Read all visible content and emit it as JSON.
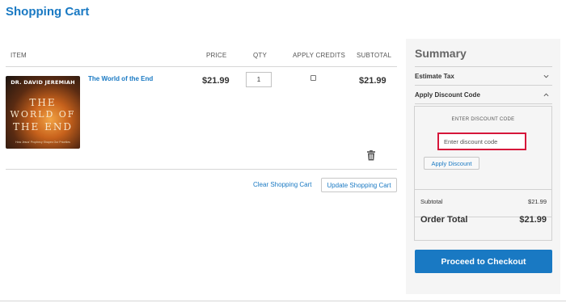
{
  "page": {
    "title": "Shopping Cart"
  },
  "cart": {
    "columns": {
      "item": "ITEM",
      "price": "PRICE",
      "qty": "QTY",
      "apply_credits": "APPLY CREDITS",
      "subtotal": "SUBTOTAL"
    },
    "items": [
      {
        "name": "The World of the End",
        "price": "$21.99",
        "qty": "1",
        "apply_credits": false,
        "subtotal": "$21.99",
        "cover": {
          "author": "DR. DAVID JEREMIAH",
          "title_line1": "THE",
          "title_line2": "WORLD OF",
          "title_line3": "THE END",
          "tagline": "How Jesus' Prophecy Shapes Our Priorities"
        }
      }
    ],
    "actions": {
      "clear": "Clear Shopping Cart",
      "update": "Update Shopping Cart"
    }
  },
  "summary": {
    "title": "Summary",
    "estimate_tax": "Estimate Tax",
    "apply_discount": "Apply Discount Code",
    "discount_label": "ENTER DISCOUNT CODE",
    "discount_placeholder": "Enter discount code",
    "discount_value": "",
    "apply_button": "Apply Discount",
    "subtotal_label": "Subtotal",
    "subtotal_value": "$21.99",
    "order_total_label": "Order Total",
    "order_total_value": "$21.99",
    "checkout_button": "Proceed to Checkout"
  },
  "colors": {
    "accent": "#1979c3",
    "highlight": "#d6163a",
    "summary_bg": "#f5f5f5"
  },
  "icons": {
    "remove": "trash-icon",
    "estimate_tax_toggle": "chevron-down-icon",
    "discount_toggle": "chevron-up-icon"
  }
}
